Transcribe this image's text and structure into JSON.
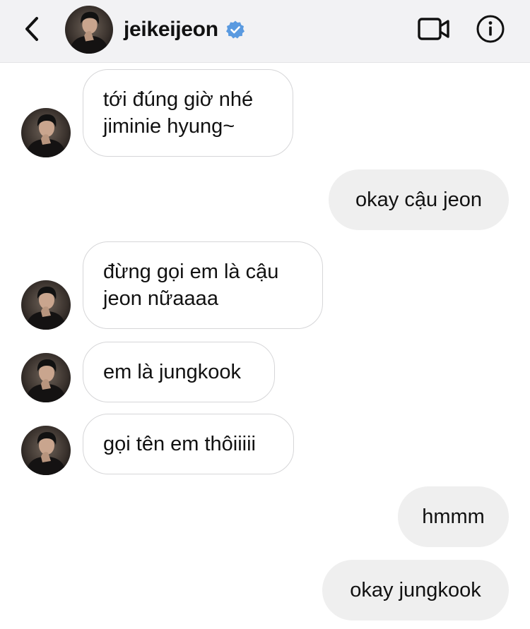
{
  "header": {
    "username": "jeikeijeon",
    "verified_color": "#5a9ae0"
  },
  "messages": [
    {
      "direction": "in",
      "text": "tới đúng giờ nhé\njiminie hyung~"
    },
    {
      "direction": "out",
      "text": "okay cậu jeon"
    },
    {
      "direction": "in",
      "text": "đừng gọi em là cậu\njeon nữaaaa"
    },
    {
      "direction": "in",
      "text": "em là jungkook"
    },
    {
      "direction": "in",
      "text": "gọi tên em thôiiiii"
    },
    {
      "direction": "out",
      "text": "hmmm"
    },
    {
      "direction": "out",
      "text": "okay jungkook"
    }
  ],
  "colors": {
    "header_bg": "#f2f2f4",
    "incoming_border": "#d6d6d8",
    "outgoing_bg": "#efefef"
  }
}
